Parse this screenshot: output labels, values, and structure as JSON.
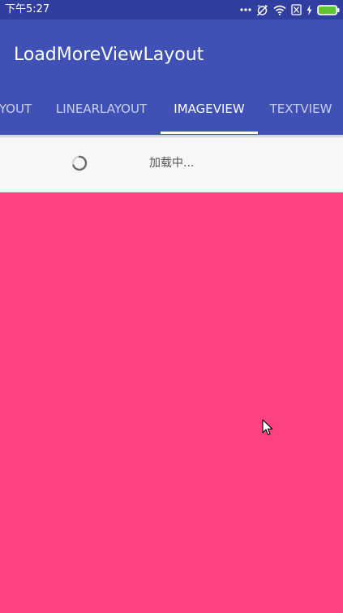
{
  "status_bar": {
    "time": "下午5:27",
    "icons": [
      "more-dots-icon",
      "alarm-off-icon",
      "wifi-icon",
      "sim-off-icon",
      "charging-icon",
      "battery-icon"
    ],
    "background_color": "#303f9f"
  },
  "app_bar": {
    "title": "LoadMoreViewLayout",
    "background_color": "#3f51b5"
  },
  "tabs": {
    "items": [
      {
        "label": "YOUT",
        "active": false
      },
      {
        "label": "LINEARLAYOUT",
        "active": false
      },
      {
        "label": "IMAGEVIEW",
        "active": true
      },
      {
        "label": "TEXTVIEW",
        "active": false
      }
    ],
    "indicator_color": "#ffffff"
  },
  "loader": {
    "text": "加载中...",
    "icon": "spinner-icon"
  },
  "content": {
    "background_color": "#ff4081"
  }
}
